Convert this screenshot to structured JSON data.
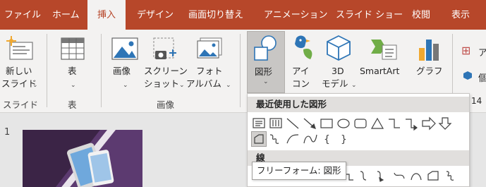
{
  "tabs": [
    "ファイル",
    "ホーム",
    "挿入",
    "デザイン",
    "画面切り替え",
    "アニメーション",
    "スライド ショー",
    "校閲",
    "表示"
  ],
  "ribbon": {
    "new_slide": {
      "line1": "新しい",
      "line2": "スライド",
      "group": "スライド"
    },
    "table": {
      "label": "表",
      "group": "表"
    },
    "images": {
      "image": "画像",
      "screenshot_1": "スクリーン",
      "screenshot_2": "ショット",
      "album_1": "フォト",
      "album_2": "アルバム",
      "group": "画像"
    },
    "shapes": {
      "label": "図形"
    },
    "icons": {
      "line1": "アイ",
      "line2": "コン"
    },
    "model3d": {
      "line1": "3D",
      "line2": "モデル"
    },
    "smartart": {
      "label": "SmartArt"
    },
    "chart": {
      "label": "グラフ"
    },
    "right_partial_1": "ア",
    "right_partial_2": "個"
  },
  "dropdown": {
    "recent_header": "最近使用した図形",
    "lines_header": "線",
    "tooltip": "フリーフォーム: 図形"
  },
  "slides": {
    "number": "1"
  },
  "zoom_partial": "14"
}
